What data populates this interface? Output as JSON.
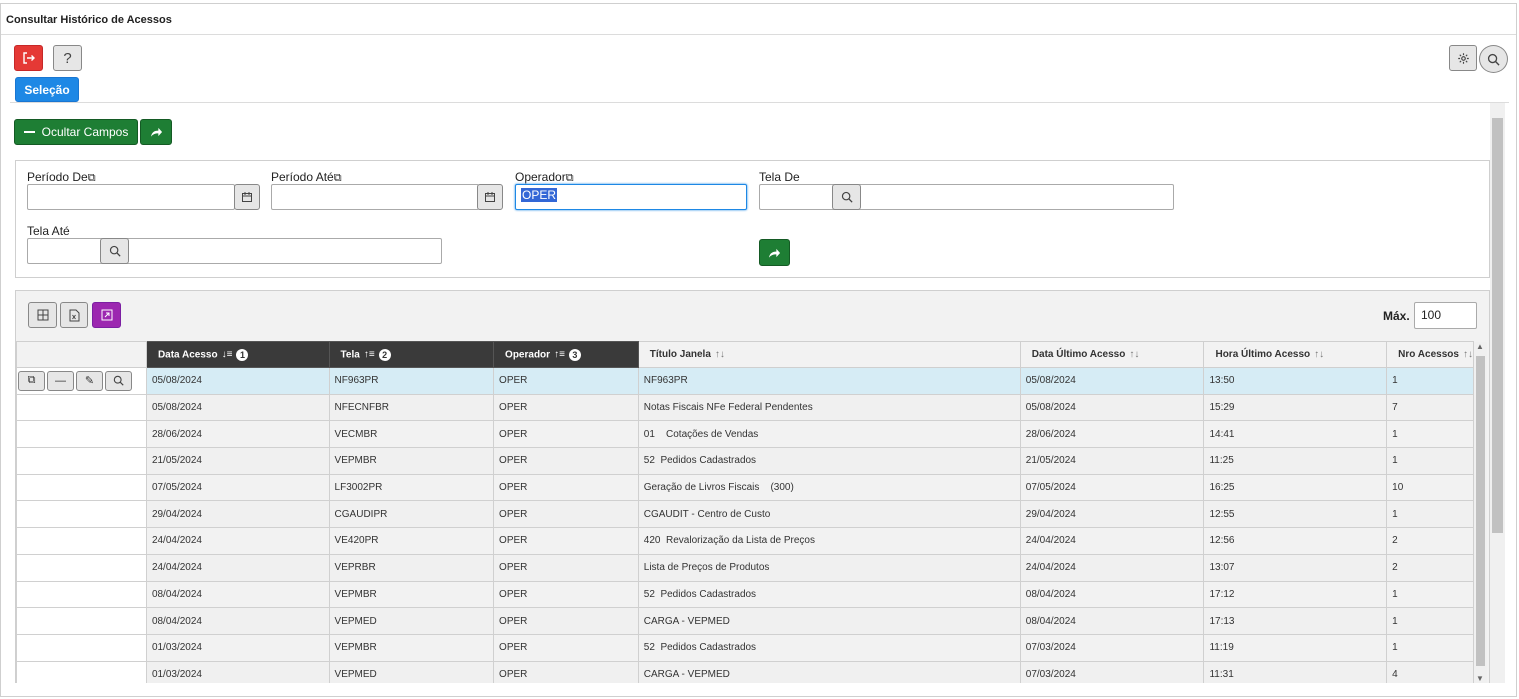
{
  "window": {
    "title": "Consultar Histórico de Acessos"
  },
  "toolbar": {
    "selection_label": "Seleção",
    "help_label": "?"
  },
  "filters": {
    "toggle_label": "Ocultar Campos",
    "periodo_de": {
      "label": "Período De",
      "value": ""
    },
    "periodo_ate": {
      "label": "Período Até",
      "value": ""
    },
    "operador": {
      "label": "Operador",
      "value": "OPER"
    },
    "tela_de": {
      "label": "Tela De",
      "value": ""
    },
    "tela_ate": {
      "label": "Tela Até",
      "value": ""
    }
  },
  "grid": {
    "max_label": "Máx.",
    "max_value": "100",
    "columns": [
      {
        "label": "Data Acesso",
        "sort": "desc",
        "order": "1"
      },
      {
        "label": "Tela",
        "sort": "asc",
        "order": "2"
      },
      {
        "label": "Operador",
        "sort": "asc",
        "order": "3"
      },
      {
        "label": "Título Janela",
        "sort": "none",
        "order": ""
      },
      {
        "label": "Data Último Acesso",
        "sort": "none",
        "order": ""
      },
      {
        "label": "Hora Último Acesso",
        "sort": "none",
        "order": ""
      },
      {
        "label": "Nro Acessos",
        "sort": "none",
        "order": ""
      }
    ],
    "rows": [
      [
        "05/08/2024",
        "NF963PR",
        "OPER",
        "NF963PR",
        "05/08/2024",
        "13:50",
        "1"
      ],
      [
        "05/08/2024",
        "NFECNFBR",
        "OPER",
        "Notas Fiscais NFe Federal Pendentes",
        "05/08/2024",
        "15:29",
        "7"
      ],
      [
        "28/06/2024",
        "VECMBR",
        "OPER",
        "01    Cotações de Vendas",
        "28/06/2024",
        "14:41",
        "1"
      ],
      [
        "21/05/2024",
        "VEPMBR",
        "OPER",
        "52  Pedidos Cadastrados",
        "21/05/2024",
        "11:25",
        "1"
      ],
      [
        "07/05/2024",
        "LF3002PR",
        "OPER",
        "Geração de Livros Fiscais    (300)",
        "07/05/2024",
        "16:25",
        "10"
      ],
      [
        "29/04/2024",
        "CGAUDIPR",
        "OPER",
        "CGAUDIT - Centro de Custo",
        "29/04/2024",
        "12:55",
        "1"
      ],
      [
        "24/04/2024",
        "VE420PR",
        "OPER",
        "420  Revalorização da Lista de Preços",
        "24/04/2024",
        "12:56",
        "2"
      ],
      [
        "24/04/2024",
        "VEPRBR",
        "OPER",
        "Lista de Preços de Produtos",
        "24/04/2024",
        "13:07",
        "2"
      ],
      [
        "08/04/2024",
        "VEPMBR",
        "OPER",
        "52  Pedidos Cadastrados",
        "08/04/2024",
        "17:12",
        "1"
      ],
      [
        "08/04/2024",
        "VEPMED",
        "OPER",
        "CARGA - VEPMED",
        "08/04/2024",
        "17:13",
        "1"
      ],
      [
        "01/03/2024",
        "VEPMBR",
        "OPER",
        "52  Pedidos Cadastrados",
        "07/03/2024",
        "11:19",
        "1"
      ],
      [
        "01/03/2024",
        "VEPMED",
        "OPER",
        "CARGA - VEPMED",
        "07/03/2024",
        "11:31",
        "4"
      ]
    ]
  }
}
